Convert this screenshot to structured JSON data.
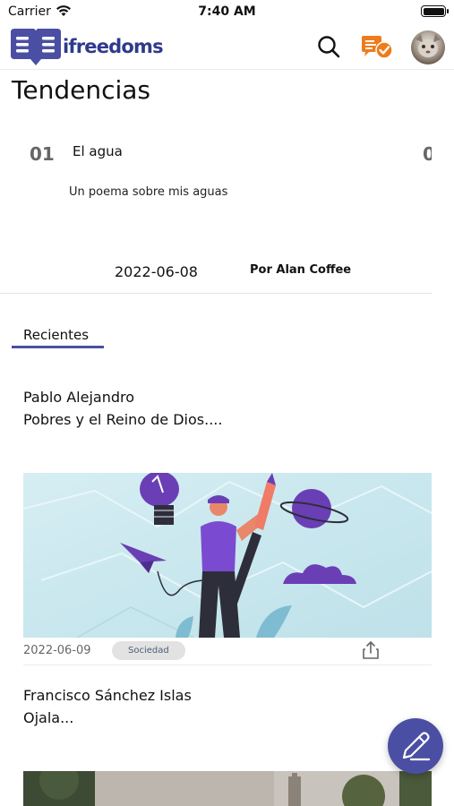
{
  "status_bar": {
    "carrier": "Carrier",
    "time": "7:40 AM",
    "wifi_icon": "wifi-icon",
    "battery_icon": "battery-icon"
  },
  "header": {
    "logo_text": "ifreedoms",
    "search_icon": "search-icon",
    "notes_icon": "notes-check-icon",
    "avatar": "user-avatar"
  },
  "trending": {
    "title": "Tendencias",
    "card": {
      "number": "01",
      "next_number_peek": "0",
      "title": "El agua",
      "description": "Un poema sobre mis aguas",
      "date": "2022-06-08",
      "author": "Por Alan Coffee"
    }
  },
  "recent_tab": {
    "label": "Recientes"
  },
  "posts": [
    {
      "author": "Pablo Alejandro",
      "title": "Pobres y el Reino de Dios....",
      "date": "2022-06-09",
      "category": "Sociedad",
      "share_icon": "share-icon"
    },
    {
      "author": "Francisco Sánchez Islas",
      "title": "Ojala..."
    }
  ],
  "fab": {
    "icon": "pencil-icon"
  },
  "colors": {
    "brand": "#4b4fa3",
    "logo_text": "#2e3a8c",
    "notes_icon": "#f07b1a",
    "badge_bg": "#e2e2e2"
  }
}
